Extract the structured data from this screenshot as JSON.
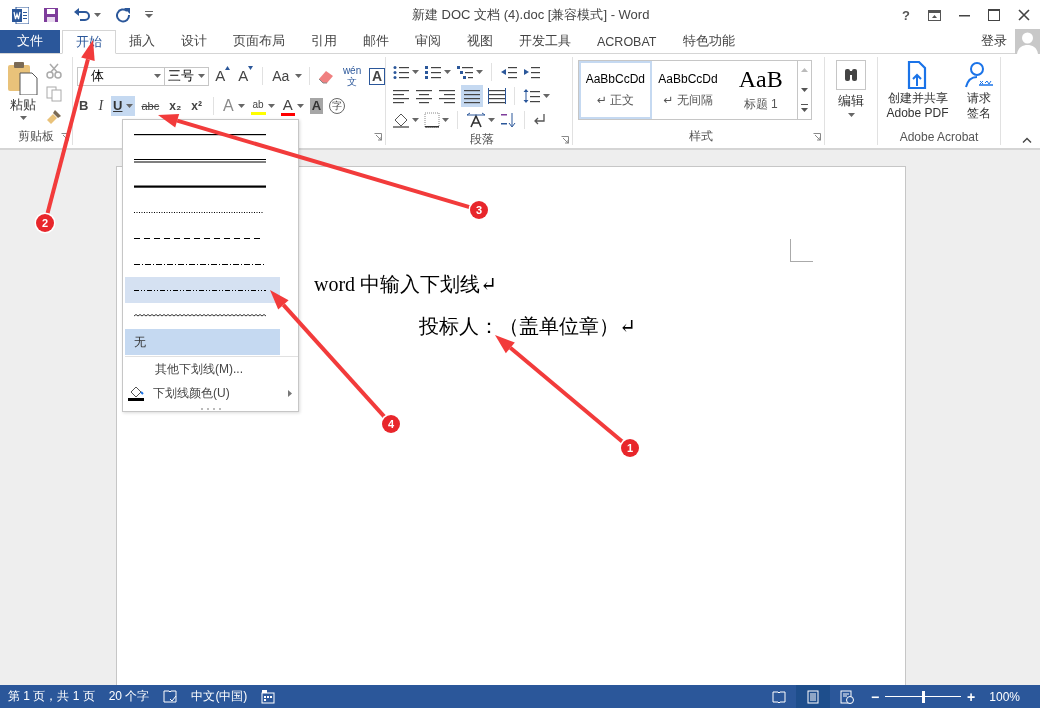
{
  "window": {
    "title": "新建 DOC 文档 (4).doc [兼容模式] - Word",
    "help": "?"
  },
  "tabs": [
    {
      "label": "文件",
      "kind": "file",
      "selected": false
    },
    {
      "label": "开始",
      "kind": "tab",
      "selected": true
    },
    {
      "label": "插入",
      "kind": "tab",
      "selected": false
    },
    {
      "label": "设计",
      "kind": "tab",
      "selected": false
    },
    {
      "label": "页面布局",
      "kind": "tab",
      "selected": false
    },
    {
      "label": "引用",
      "kind": "tab",
      "selected": false
    },
    {
      "label": "邮件",
      "kind": "tab",
      "selected": false
    },
    {
      "label": "审阅",
      "kind": "tab",
      "selected": false
    },
    {
      "label": "视图",
      "kind": "tab",
      "selected": false
    },
    {
      "label": "开发工具",
      "kind": "tab",
      "selected": false
    },
    {
      "label": "ACROBAT",
      "kind": "tab",
      "selected": false
    },
    {
      "label": "特色功能",
      "kind": "tab",
      "selected": false
    }
  ],
  "account": {
    "label": "登录"
  },
  "clipboard": {
    "label": "剪贴板",
    "paste": "粘贴"
  },
  "font": {
    "font_name": "体",
    "font_size": "三号",
    "row1": [
      {
        "kind": "grow",
        "label": "A"
      },
      {
        "kind": "shrink",
        "label": "A"
      },
      {
        "kind": "case",
        "label": "Aa"
      },
      {
        "kind": "clear"
      },
      {
        "kind": "phonetic",
        "label": "wén 文"
      },
      {
        "kind": "border",
        "label": "A"
      }
    ],
    "row2": [
      {
        "kind": "bold",
        "label": "B",
        "selected": false
      },
      {
        "kind": "italic",
        "label": "I",
        "selected": false
      },
      {
        "kind": "underline",
        "label": "U",
        "selected": true
      },
      {
        "kind": "strike",
        "label": "abc",
        "selected": false
      },
      {
        "kind": "sub",
        "label": "x₂",
        "selected": false
      },
      {
        "kind": "sup",
        "label": "x²",
        "selected": false
      },
      {
        "kind": "effects",
        "label": "A",
        "selected": false
      },
      {
        "kind": "highlight",
        "label": "ab",
        "selected": false
      },
      {
        "kind": "color",
        "label": "A",
        "selected": false
      },
      {
        "kind": "shading",
        "label": "A",
        "selected": false
      },
      {
        "kind": "enclose",
        "label": "字",
        "selected": false
      }
    ]
  },
  "paragraph": {
    "label": "段落",
    "justify_selected": true
  },
  "styles": {
    "label": "样式",
    "items": [
      {
        "preview": "AaBbCcDd",
        "name": "↵ 正文",
        "kind": "normal",
        "selected": true
      },
      {
        "preview": "AaBbCcDd",
        "name": "↵ 无间隔",
        "kind": "normal",
        "selected": false
      },
      {
        "preview": "AaB",
        "name": "标题 1",
        "kind": "heading",
        "selected": false
      }
    ]
  },
  "editing": {
    "label": "编辑"
  },
  "acrobat": {
    "label": "Adobe Acrobat",
    "buttons": [
      {
        "kind": "pdf",
        "label": "创建并共享 Adobe PDF"
      },
      {
        "kind": "sign",
        "label": "请求签名"
      }
    ]
  },
  "document": {
    "lines": [
      "word 中输入下划线↵",
      "投标人：（盖单位章）↵"
    ]
  },
  "underline_menu": {
    "styles": [
      {
        "kind": "single",
        "selected": false,
        "highlighted": false
      },
      {
        "kind": "double",
        "selected": false,
        "highlighted": false
      },
      {
        "kind": "thick",
        "selected": false,
        "highlighted": false
      },
      {
        "kind": "dotted",
        "selected": false,
        "highlighted": false
      },
      {
        "kind": "dashed",
        "selected": false,
        "highlighted": false
      },
      {
        "kind": "dashdot",
        "selected": false,
        "highlighted": false
      },
      {
        "kind": "dashdotdot",
        "selected": false,
        "highlighted": true
      },
      {
        "kind": "wave",
        "selected": false,
        "highlighted": false
      }
    ],
    "none_item": {
      "label": "无",
      "selected": true
    },
    "more": "其他下划线(M)...",
    "color_option": "下划线颜色(U)"
  },
  "status_bar": {
    "page": "第 1 页，共 1 页",
    "words": "20 个字",
    "language": "中文(中国)",
    "views": [
      {
        "kind": "read",
        "selected": false
      },
      {
        "kind": "print",
        "selected": true
      },
      {
        "kind": "web",
        "selected": false
      }
    ],
    "zoom": {
      "minus": "−",
      "plus": "+",
      "level": 0.5,
      "percent": "100%"
    }
  },
  "annotations": [
    {
      "number": "1"
    },
    {
      "number": "2"
    },
    {
      "number": "3"
    },
    {
      "number": "4"
    }
  ]
}
